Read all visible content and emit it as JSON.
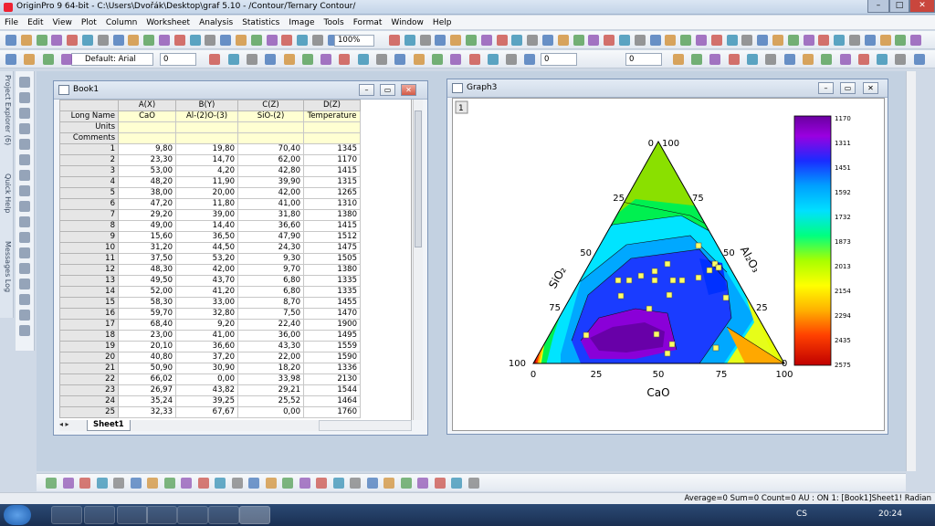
{
  "window": {
    "title": "OriginPro 9 64-bit - C:\\Users\\Dvořák\\Desktop\\graf 5.10 - /Contour/Ternary Contour/"
  },
  "menu": [
    "File",
    "Edit",
    "View",
    "Plot",
    "Column",
    "Worksheet",
    "Analysis",
    "Statistics",
    "Image",
    "Tools",
    "Format",
    "Window",
    "Help"
  ],
  "toolbar": {
    "zoom": "100%",
    "font": "Default: Arial",
    "font_size": "0",
    "line_width": "0",
    "pattern_width": "0"
  },
  "side_tabs": [
    "Project Explorer (6)",
    "Quick Help",
    "Messages Log"
  ],
  "book": {
    "title": "Book1",
    "columns": [
      "A(X)",
      "B(Y)",
      "C(Z)",
      "D(Z)"
    ],
    "meta_labels": [
      "Long Name",
      "Units",
      "Comments"
    ],
    "long_names": [
      "CaO",
      "Al‑(2)O‑(3)",
      "SiO‑(2)",
      "Temperature"
    ],
    "rows": [
      [
        "1",
        "9,80",
        "19,80",
        "70,40",
        "1345"
      ],
      [
        "2",
        "23,30",
        "14,70",
        "62,00",
        "1170"
      ],
      [
        "3",
        "53,00",
        "4,20",
        "42,80",
        "1415"
      ],
      [
        "4",
        "48,20",
        "11,90",
        "39,90",
        "1315"
      ],
      [
        "5",
        "38,00",
        "20,00",
        "42,00",
        "1265"
      ],
      [
        "6",
        "47,20",
        "11,80",
        "41,00",
        "1310"
      ],
      [
        "7",
        "29,20",
        "39,00",
        "31,80",
        "1380"
      ],
      [
        "8",
        "49,00",
        "14,40",
        "36,60",
        "1415"
      ],
      [
        "9",
        "15,60",
        "36,50",
        "47,90",
        "1512"
      ],
      [
        "10",
        "31,20",
        "44,50",
        "24,30",
        "1475"
      ],
      [
        "11",
        "37,50",
        "53,20",
        "9,30",
        "1505"
      ],
      [
        "12",
        "48,30",
        "42,00",
        "9,70",
        "1380"
      ],
      [
        "13",
        "49,50",
        "43,70",
        "6,80",
        "1335"
      ],
      [
        "14",
        "52,00",
        "41,20",
        "6,80",
        "1335"
      ],
      [
        "15",
        "58,30",
        "33,00",
        "8,70",
        "1455"
      ],
      [
        "16",
        "59,70",
        "32,80",
        "7,50",
        "1470"
      ],
      [
        "17",
        "68,40",
        "9,20",
        "22,40",
        "1900"
      ],
      [
        "18",
        "23,00",
        "41,00",
        "36,00",
        "1495"
      ],
      [
        "19",
        "20,10",
        "36,60",
        "43,30",
        "1559"
      ],
      [
        "20",
        "40,80",
        "37,20",
        "22,00",
        "1590"
      ],
      [
        "21",
        "50,90",
        "30,90",
        "18,20",
        "1336"
      ],
      [
        "22",
        "66,02",
        "0,00",
        "33,98",
        "2130"
      ],
      [
        "23",
        "26,97",
        "43,82",
        "29,21",
        "1544"
      ],
      [
        "24",
        "35,24",
        "39,25",
        "25,52",
        "1464"
      ],
      [
        "25",
        "32,33",
        "67,67",
        "0,00",
        "1760"
      ]
    ],
    "sheet_tab": "Sheet1"
  },
  "graph": {
    "title": "Graph3",
    "layer": "1",
    "bottom_label": "CaO",
    "left_label": "SiO₂",
    "right_label": "Al₂O₃",
    "bottom_ticks": [
      "0",
      "25",
      "50",
      "75",
      "100"
    ],
    "left_ticks": [
      "100",
      "75",
      "50",
      "25",
      "0"
    ],
    "right_ticks": [
      "100",
      "75",
      "50",
      "25",
      "0"
    ],
    "colorbar_labels": [
      "1170",
      "1311",
      "1451",
      "1592",
      "1732",
      "1873",
      "2013",
      "2154",
      "2294",
      "2435",
      "2575"
    ]
  },
  "status": "Average=0 Sum=0 Count=0  AU : ON    1: [Book1]Sheet1!  Radian",
  "taskbar": {
    "lang": "CS",
    "time": "20:24"
  },
  "colors": {
    "accent": "#7d95b8",
    "sheet_meta": "#ffffd2"
  }
}
